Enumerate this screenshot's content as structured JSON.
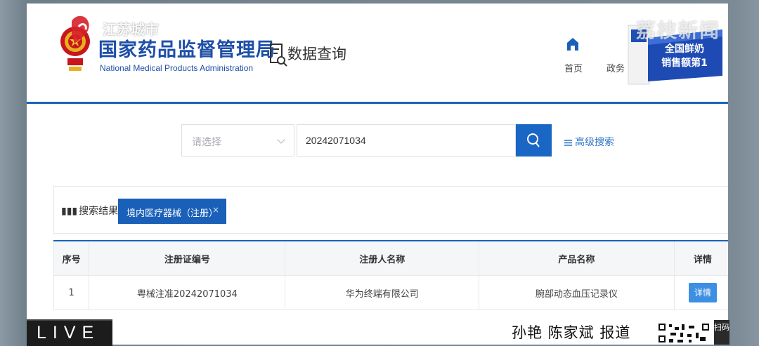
{
  "header": {
    "org_name_cn": "国家药品监督管理局",
    "org_name_en": "National Medical Products Administration",
    "section_title": "数据查询",
    "nav": {
      "home": "首页",
      "gov": "政务"
    }
  },
  "search": {
    "select_placeholder": "请选择",
    "query": "20242071034",
    "advanced_label": "高级搜索"
  },
  "results": {
    "label": "搜索结果：",
    "filter_tag": "境内医疗器械（注册）",
    "filter_tag_close": "×"
  },
  "table": {
    "columns": [
      "序号",
      "注册证编号",
      "注册人名称",
      "产品名称",
      "详情"
    ],
    "rows": [
      {
        "index": "1",
        "cert_no": "粤械注准20242071034",
        "registrant": "华为终端有限公司",
        "product": "腕部动态血压记录仪",
        "detail": "详情"
      }
    ]
  },
  "overlay": {
    "channel_name": "江苏城市",
    "watermark": "荔枝新闻",
    "ad_line1": "全国鲜奶",
    "ad_line2": "销售额第1",
    "live": "LIVE",
    "reporters": "孙艳 陈家斌 报道",
    "scan": "扫码"
  },
  "colors": {
    "primary_blue": "#1a63b7",
    "search_button": "#1a66c4",
    "detail_button": "#3d8fe3",
    "link_blue": "#2a72c8"
  }
}
